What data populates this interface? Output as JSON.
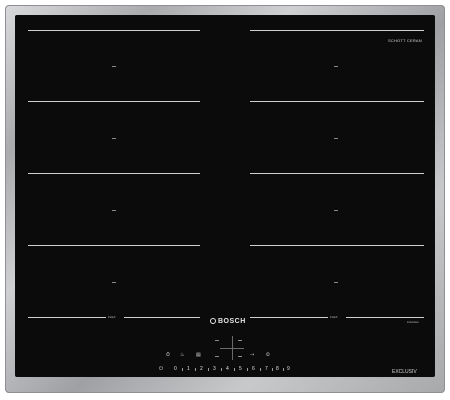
{
  "product": {
    "brand": "BOSCH",
    "model_badge": "EXCLUSIV",
    "glass_brand": "SCHOTT CERAN",
    "cooking_type": "induction",
    "flex_label_left": "FLEX",
    "flex_label_right": "FLEX"
  },
  "zones": [
    {
      "row": 1,
      "side": "left"
    },
    {
      "row": 1,
      "side": "right"
    },
    {
      "row": 2,
      "side": "left"
    },
    {
      "row": 2,
      "side": "right"
    },
    {
      "row": 3,
      "side": "left"
    },
    {
      "row": 3,
      "side": "right"
    },
    {
      "row": 4,
      "side": "left"
    },
    {
      "row": 4,
      "side": "right"
    }
  ],
  "controls": {
    "power_symbol": "⏻",
    "slider_digits": [
      "0",
      "1",
      "2",
      "3",
      "4",
      "5",
      "6",
      "7",
      "8",
      "9"
    ],
    "power_symbol_right": "⏲"
  },
  "colors": {
    "glass": "#0b0b0c",
    "frame": "#b0b2b4",
    "markings": "#d6d6d6"
  }
}
